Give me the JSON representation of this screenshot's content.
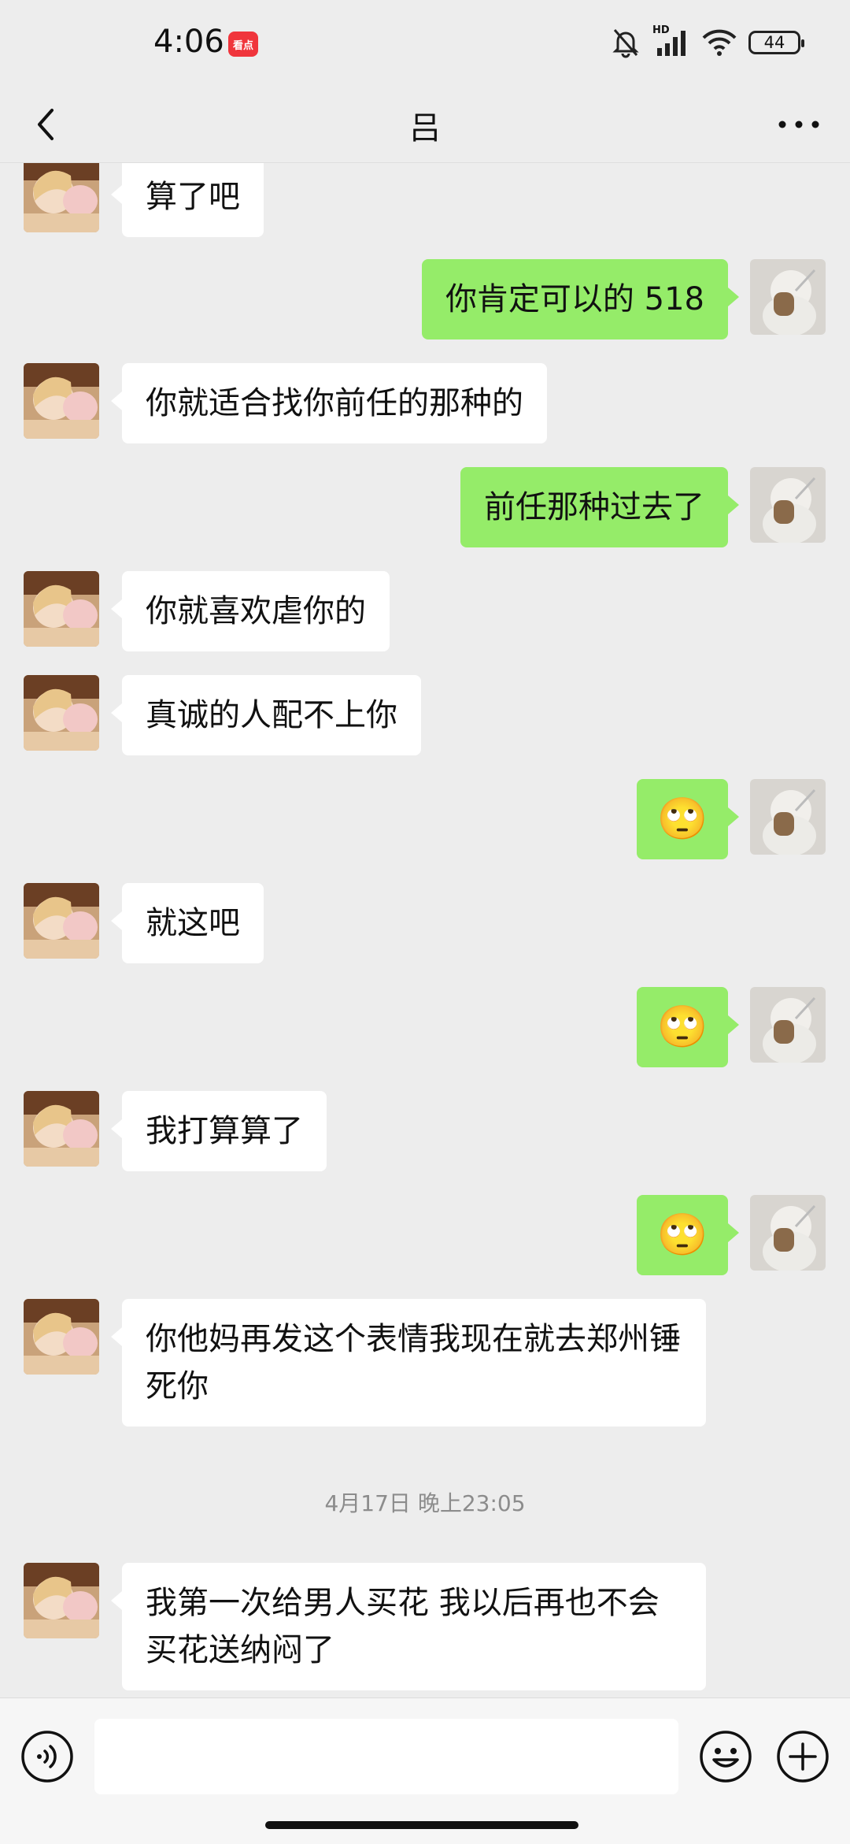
{
  "status_bar": {
    "time": "4:06",
    "app_badge": "看点",
    "network": "HD",
    "battery": "44"
  },
  "header": {
    "title": "吕",
    "back_icon": "chevron-left-icon",
    "more_icon": "more-dots-icon"
  },
  "messages": [
    {
      "side": "in",
      "text": "算了吧"
    },
    {
      "side": "out",
      "text": "你肯定可以的 518"
    },
    {
      "side": "in",
      "text": "你就适合找你前任的那种的"
    },
    {
      "side": "out",
      "text": "前任那种过去了"
    },
    {
      "side": "in",
      "text": "你就喜欢虐你的"
    },
    {
      "side": "in",
      "text": "真诚的人配不上你"
    },
    {
      "side": "out",
      "text": "🙄"
    },
    {
      "side": "in",
      "text": "就这吧"
    },
    {
      "side": "out",
      "text": "🙄"
    },
    {
      "side": "in",
      "text": "我打算算了"
    },
    {
      "side": "out",
      "text": "🙄"
    },
    {
      "side": "in",
      "text": "你他妈再发这个表情我现在就去郑州锤死你"
    },
    {
      "side": "timestamp",
      "text": "4月17日 晚上23:05"
    },
    {
      "side": "in",
      "text": "我第一次给男人买花 我以后再也不会买花送纳闷了"
    }
  ],
  "input_bar": {
    "voice_icon": "voice-icon",
    "emoji_icon": "emoji-icon",
    "plus_icon": "plus-icon",
    "input_value": ""
  }
}
